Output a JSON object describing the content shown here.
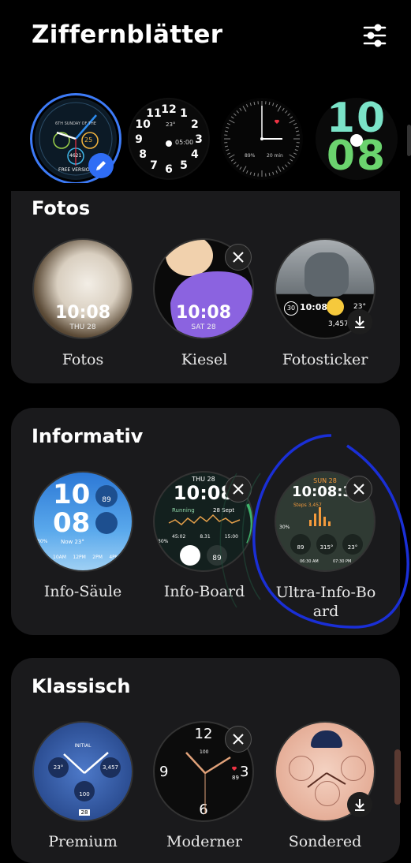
{
  "header": {
    "title": "Ziffernblätter"
  },
  "top_faces": {
    "f1": {
      "label": "FREE VERSION",
      "top_line": "6TH SUNDAY OF THE",
      "vals": [
        "25",
        "4621",
        "72"
      ]
    },
    "f2": {
      "weather": "23°",
      "time": "05:00",
      "nums": [
        "12",
        "1",
        "2",
        "3",
        "4",
        "5",
        "6",
        "7",
        "8",
        "9",
        "10",
        "11"
      ]
    },
    "f3": {
      "pct": "89%",
      "mins": "20 min"
    },
    "f4": {
      "hour": "10",
      "min": "08"
    }
  },
  "sections": {
    "fotos": {
      "title": "Fotos",
      "items": [
        {
          "label": "Fotos",
          "time": "10:08",
          "date": "THU 28"
        },
        {
          "label": "Kiesel",
          "time": "10:08",
          "date": "SAT 28"
        },
        {
          "label": "Fotosticker",
          "badge": "30",
          "time": "10:08",
          "weather": "23°",
          "steps": "3,457"
        }
      ]
    },
    "informativ": {
      "title": "Informativ",
      "items": [
        {
          "label": "Info-Säule",
          "hour": "10",
          "min": "08",
          "hr": "89",
          "now": "Now 23°",
          "pct": "30%",
          "hours": [
            "10AM",
            "12PM",
            "2PM",
            "4PM"
          ]
        },
        {
          "label": "Info-Board",
          "date": "THU 28",
          "time": "10:08",
          "act": "Running",
          "adate": "28 Sept",
          "stats": [
            "45:02",
            "8.31",
            "15:00"
          ],
          "hr": "89",
          "pct": "30%"
        },
        {
          "label": "Ultra-Info-Board",
          "date": "SUN 28",
          "time": "10:08:3",
          "steps": "Steps 3,457",
          "subs": [
            "89",
            "315°",
            "23°"
          ],
          "sun": [
            "06:30 AM",
            "07:30 PM"
          ],
          "pct": "30%"
        }
      ]
    },
    "klassisch": {
      "title": "Klassisch",
      "items": [
        {
          "label": "Premium",
          "logo": "INITIAL",
          "subs": [
            "23°",
            "3,457",
            "100"
          ],
          "day": "28"
        },
        {
          "label": "Moderner",
          "nums": [
            "12",
            "3",
            "6",
            "9"
          ],
          "hr": "89",
          "steps": "100"
        },
        {
          "label": "Sondered"
        }
      ]
    }
  },
  "colors": {
    "accent_blue": "#2f6df5",
    "card_bg": "#1a1a1c",
    "scribble": "#1a2fd6"
  }
}
